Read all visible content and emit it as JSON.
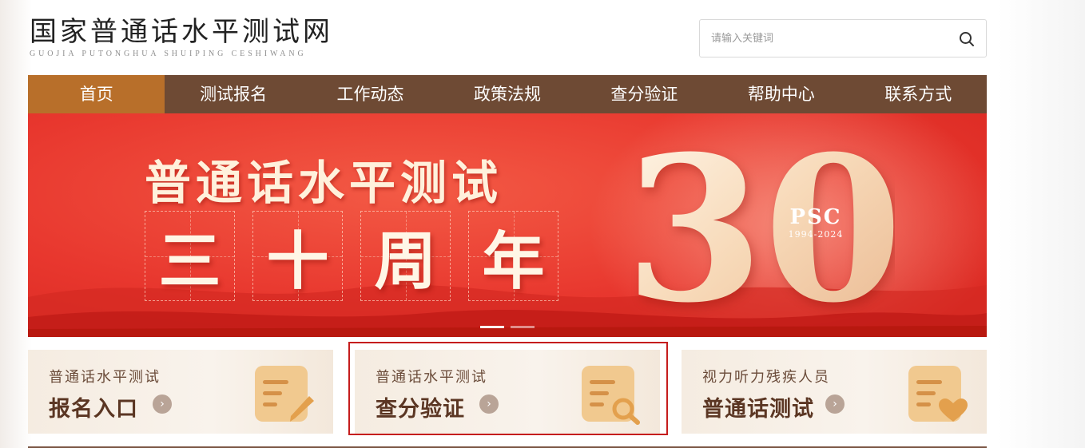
{
  "header": {
    "logo_cn": "国家普通话水平测试网",
    "logo_en": "GUOJIA PUTONGHUA SHUIPING CESHIWANG",
    "search_placeholder": "请输入关键词"
  },
  "nav": [
    {
      "label": "首页",
      "active": true
    },
    {
      "label": "测试报名",
      "active": false
    },
    {
      "label": "工作动态",
      "active": false
    },
    {
      "label": "政策法规",
      "active": false
    },
    {
      "label": "查分验证",
      "active": false
    },
    {
      "label": "帮助中心",
      "active": false
    },
    {
      "label": "联系方式",
      "active": false
    }
  ],
  "banner": {
    "title": "普通话水平测试",
    "year_chars": [
      "三",
      "十",
      "周",
      "年"
    ],
    "big_number": "30",
    "badge": "PSC",
    "badge_years": "1994-2024",
    "slides": 2,
    "active_slide": 1
  },
  "cards": [
    {
      "sub": "普通话水平测试",
      "main": "报名入口",
      "icon": "pencil-doc-icon"
    },
    {
      "sub": "普通话水平测试",
      "main": "查分验证",
      "icon": "search-doc-icon"
    },
    {
      "sub": "视力听力残疾人员",
      "main": "普通话测试",
      "icon": "heart-doc-icon"
    }
  ],
  "colors": {
    "nav_bg": "#6e4a34",
    "nav_active": "#b86f2a",
    "banner_red": "#e8372e",
    "card_bg": "#f5ece1",
    "highlight": "#c51d1d"
  }
}
